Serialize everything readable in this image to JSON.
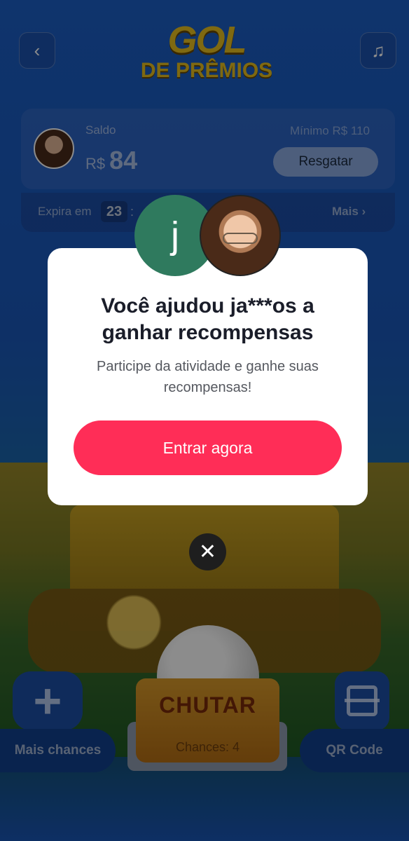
{
  "header": {
    "back_icon": "chevron-left-icon",
    "music_icon": "music-note-icon",
    "logo_line1": "GOL",
    "logo_line2": "DE PRÊMIOS"
  },
  "balance": {
    "label": "Saldo",
    "currency": "R$",
    "value": "84",
    "minimum": "Mínimo  R$ 110",
    "redeem_label": "Resgatar"
  },
  "expiry": {
    "label": "Expira em",
    "hours": "23",
    "separator": ":",
    "more_label": "Mais ›"
  },
  "modal": {
    "avatar_letter": "j",
    "title_line1": "Você ajudou ja***os a",
    "title_line2": "ganhar recompensas",
    "subtitle_line1": "Participe da atividade e ganhe suas",
    "subtitle_line2": "recompensas!",
    "cta_label": "Entrar agora",
    "close_glyph": "✕"
  },
  "bottom": {
    "more_chances_label": "Mais chances",
    "kick_label": "CHUTAR",
    "chances_label": "Chances: 4",
    "qr_label": "QR Code"
  },
  "colors": {
    "accent": "#ff2d57",
    "logo": "#e7c01f",
    "avatar_green": "#2f7a5e"
  }
}
